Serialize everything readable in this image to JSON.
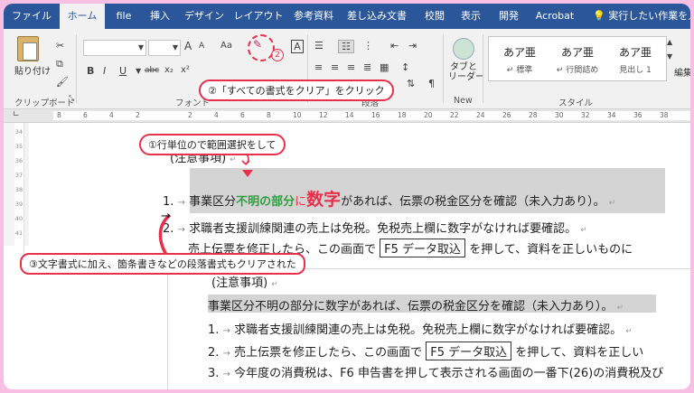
{
  "ribbon": {
    "tabs": [
      "ファイル",
      "ホーム",
      "file",
      "挿入",
      "デザイン",
      "レイアウト",
      "参考資料",
      "差し込み文書",
      "校閲",
      "表示",
      "開発",
      "Acrobat"
    ],
    "active_tab": "ホーム",
    "tell_me": "実行したい作業を入",
    "paste_label": "貼り付け",
    "bold": "B",
    "italic": "I",
    "underline": "U",
    "strike": "abc",
    "subscript": "x₂",
    "superscript": "x²",
    "font_grow": "A",
    "font_shrink": "A",
    "case": "Aa",
    "tab_reader": "タブと\nリーダー",
    "edit_label": "編集",
    "groups": {
      "clipboard": "クリップボード",
      "font": "フォント",
      "paragraph": "段落",
      "new": "New",
      "style": "スタイル"
    },
    "styles": [
      {
        "sample": "あア亜",
        "name": "↵ 標準"
      },
      {
        "sample": "あア亜",
        "name": "↵ 行間詰め"
      },
      {
        "sample": "あア亜",
        "name": "見出し 1"
      }
    ]
  },
  "ruler": {
    "numbers": [
      "8",
      "6",
      "4",
      "2",
      "",
      "2",
      "4",
      "6",
      "8",
      "10",
      "12",
      "14",
      "16",
      "18",
      "20",
      "22",
      "24",
      "26",
      "28",
      "30",
      "32",
      "34",
      "36",
      "38"
    ],
    "vertical": [
      "34",
      "35",
      "36",
      "37",
      "38",
      "39",
      "40",
      "41"
    ]
  },
  "callouts": {
    "step1": "①行単位ので範囲選択をして",
    "step2": "②「すべての書式をクリア」をクリック",
    "step3": "③文字書式に加え、箇条書きなどの段落書式もクリアされた"
  },
  "document_before": {
    "heading": "(注意事項)",
    "item1": {
      "num": "1.",
      "part1": "事業区分",
      "part2": "不明の部分",
      "part3": "に",
      "part4": "数字",
      "part5": "があれば、伝票の税金区分を確認（未入力あり）。"
    },
    "item2": {
      "num": "2.",
      "text": "求職者支援訓練関連の売上は免税。免税売上欄に数字がなければ要確認。"
    },
    "item3_partial": "売上伝票を修正したら、この画面で",
    "item3_box": "F5 データ取込",
    "item3_rest": "を押して、資料を正しいものに"
  },
  "document_after": {
    "heading": "(注意事項)",
    "line1": "事業区分不明の部分に数字があれば、伝票の税金区分を確認（未入力あり）。",
    "item2": {
      "num": "1.",
      "text": "求職者支援訓練関連の売上は免税。免税売上欄に数字がなければ要確認。"
    },
    "item3": {
      "num": "2.",
      "text1": "売上伝票を修正したら、この画面で",
      "box": "F5 データ取込",
      "text2": "を押して、資料を正しい"
    },
    "item4": {
      "num": "3.",
      "text": "今年度の消費税は、F6 申告書を押して表示される画面の一番下(26)の消費税及び"
    }
  },
  "colors": {
    "accent": "#2b579a",
    "highlight_green": "#2e9e3f",
    "highlight_red": "#e8304a",
    "callout": "#e8304a",
    "selection": "#d4d4d4"
  }
}
